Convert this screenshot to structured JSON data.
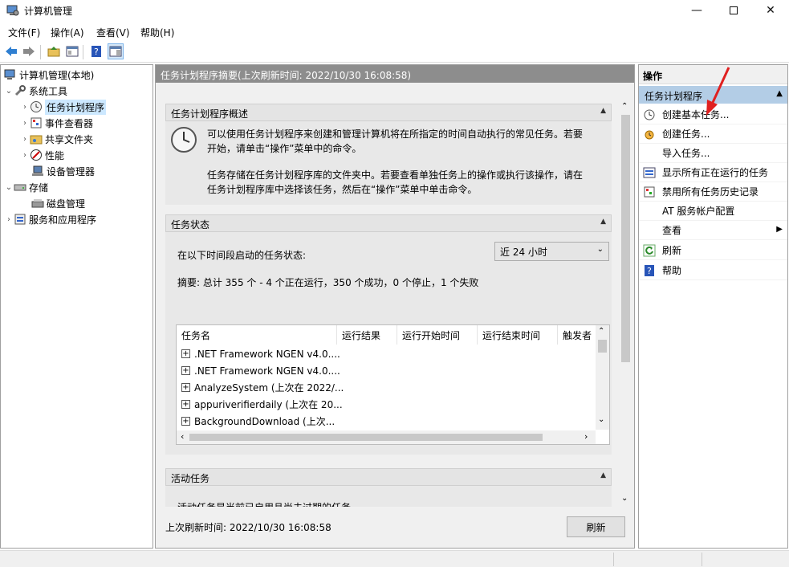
{
  "window": {
    "title": "计算机管理"
  },
  "menu": [
    "文件(F)",
    "操作(A)",
    "查看(V)",
    "帮助(H)"
  ],
  "tree": [
    {
      "label": "计算机管理(本地)",
      "icon": "computer-icon"
    },
    {
      "label": "系统工具",
      "icon": "tools-icon"
    },
    {
      "label": "任务计划程序",
      "icon": "clock-icon"
    },
    {
      "label": "事件查看器",
      "icon": "event-viewer-icon"
    },
    {
      "label": "共享文件夹",
      "icon": "shared-folder-icon"
    },
    {
      "label": "性能",
      "icon": "performance-icon"
    },
    {
      "label": "设备管理器",
      "icon": "device-manager-icon"
    },
    {
      "label": "存储",
      "icon": "storage-icon"
    },
    {
      "label": "磁盘管理",
      "icon": "disk-icon"
    },
    {
      "label": "服务和应用程序",
      "icon": "services-icon"
    }
  ],
  "center": {
    "header": "任务计划程序摘要(上次刷新时间: 2022/10/30 16:08:58)",
    "overview": {
      "title": "任务计划程序概述",
      "line1": "可以使用任务计划程序来创建和管理计算机将在所指定的时间自动执行的常见任务。若要",
      "line2": "开始，请单击“操作”菜单中的命令。",
      "line3": "任务存储在任务计划程序库的文件夹中。若要查看单独任务上的操作或执行该操作，请在",
      "line4": "任务计划程序库中选择该任务，然后在“操作”菜单中单击命令。"
    },
    "status": {
      "title": "任务状态",
      "range_label": "在以下时间段启动的任务状态:",
      "range_value": "近 24 小时",
      "summary": "摘要: 总计 355 个 - 4 个正在运行，350 个成功，0 个停止，1 个失败"
    },
    "table": {
      "columns": [
        "任务名",
        "运行结果",
        "运行开始时间",
        "运行结束时间",
        "触发者"
      ],
      "rows": [
        ".NET Framework NGEN v4.0....",
        ".NET Framework NGEN v4.0....",
        "AnalyzeSystem (上次在 2022/...",
        "appuriverifierdaily (上次在 20...",
        "BackgroundDownload (上次..."
      ]
    },
    "active": {
      "title": "活动任务",
      "partial": "活动任务是当前已启用且尚未过期的任务。"
    },
    "footer_time": "上次刷新时间: 2022/10/30 16:08:58",
    "refresh_button": "刷新"
  },
  "actions": {
    "title": "操作",
    "subtitle": "任务计划程序",
    "items": [
      {
        "label": "创建基本任务...",
        "icon": "create-basic-task-icon"
      },
      {
        "label": "创建任务...",
        "icon": "create-task-icon"
      },
      {
        "label": "导入任务...",
        "icon": ""
      },
      {
        "label": "显示所有正在运行的任务",
        "icon": "running-tasks-icon"
      },
      {
        "label": "禁用所有任务历史记录",
        "icon": "history-icon"
      },
      {
        "label": "AT 服务帐户配置",
        "icon": ""
      },
      {
        "label": "查看",
        "icon": ""
      },
      {
        "label": "刷新",
        "icon": "refresh-icon"
      },
      {
        "label": "帮助",
        "icon": "help-icon"
      }
    ]
  },
  "colors": {
    "selection": "#cce8ff",
    "action_header": "#b3cde6",
    "center_header": "#8d8d8d",
    "annotation_arrow": "#e02020"
  }
}
